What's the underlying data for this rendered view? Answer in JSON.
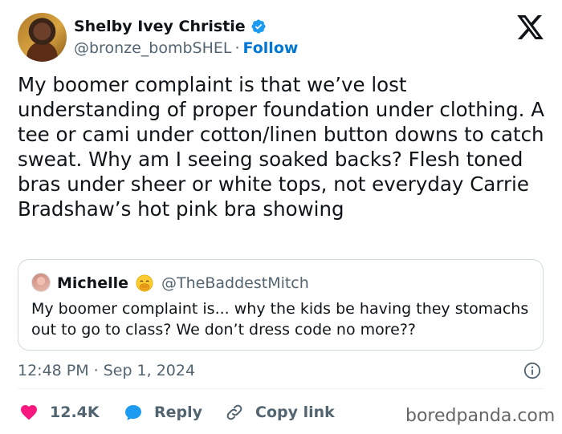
{
  "author": {
    "name": "Shelby Ivey Christie",
    "handle": "@bronze_bombSHEL",
    "separator": "·",
    "follow_label": "Follow"
  },
  "tweet": {
    "text": "My boomer complaint is that we’ve lost understanding of proper foundation under clothing. A tee or cami under cotton/linen button downs to catch sweat. Why am I seeing soaked backs? Flesh toned bras under sheer or white tops, not everyday Carrie Bradshaw’s hot pink bra showing"
  },
  "quote": {
    "name": "Michelle",
    "emoji": "🤭",
    "handle": "@TheBaddestMitch",
    "text": "My boomer complaint is... why the kids be having they stomachs out to go to class? We don’t dress code no more??"
  },
  "meta": {
    "time": "12:48 PM",
    "separator": "·",
    "date": "Sep 1, 2024"
  },
  "actions": {
    "likes_count": "12.4K",
    "reply_label": "Reply",
    "copy_link_label": "Copy link"
  },
  "watermark": "boredpanda.com",
  "colors": {
    "accent": "#1d9bf0",
    "like": "#f91880",
    "follow": "#0077d4",
    "muted": "#536471",
    "text": "#0f1419"
  },
  "icons": [
    "verified-badge-icon",
    "x-logo-icon",
    "info-icon",
    "heart-icon",
    "reply-bubble-icon",
    "link-icon",
    "emoji-face-hand-over-mouth"
  ]
}
